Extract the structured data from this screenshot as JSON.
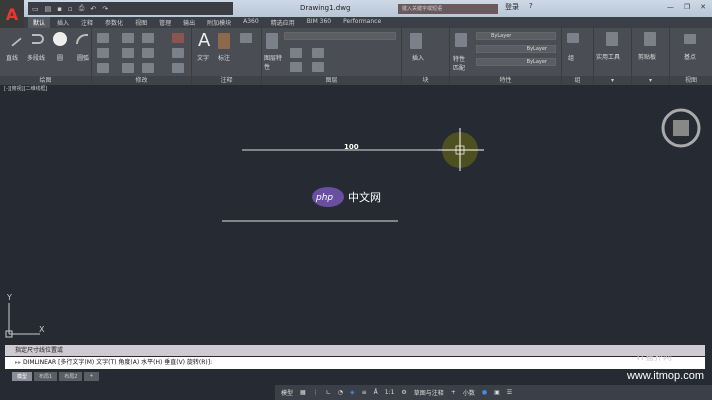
{
  "app": {
    "title": "Drawing1.dwg",
    "search_placeholder": "键入关键字或短语",
    "user": "登录",
    "help": "?"
  },
  "qat": [
    "新建",
    "打开",
    "保存",
    "另存",
    "打印",
    "放弃",
    "重做"
  ],
  "tabs": [
    "默认",
    "插入",
    "注释",
    "参数化",
    "视图",
    "管理",
    "输出",
    "附加模块",
    "A360",
    "精选应用",
    "BIM 360",
    "Performance"
  ],
  "ribbon": {
    "draw": {
      "label": "绘图",
      "items": [
        "直线",
        "多段线",
        "圆",
        "圆弧"
      ]
    },
    "modify": {
      "label": "修改"
    },
    "annotation": {
      "label": "注释",
      "items": [
        "文字",
        "标注"
      ]
    },
    "layers": {
      "label": "图层",
      "items": [
        "图层特性"
      ]
    },
    "block": {
      "label": "块",
      "items": [
        "插入"
      ]
    },
    "properties": {
      "label": "特性",
      "items": [
        "特性匹配"
      ],
      "color": "ByLayer",
      "linetype": "ByLayer",
      "lineweight": "ByLayer"
    },
    "groups": {
      "label": "组",
      "items": [
        "组"
      ]
    },
    "utilities": {
      "label": "实用工具"
    },
    "clipboard": {
      "label": "剪贴板",
      "items": [
        "剪贴板"
      ]
    },
    "view": {
      "label": "视图",
      "items": [
        "基点"
      ]
    }
  },
  "viewport_label": "[-][俯视][二维线框]",
  "drawing": {
    "dimension_text": "100",
    "ucs_x": "X",
    "ucs_y": "Y",
    "watermark_logo": "php中文网"
  },
  "command": {
    "history": "指定尺寸线位置或",
    "prompt": "DIMLINEAR [多行文字(M) 文字(T) 角度(A) 水平(H) 垂直(V) 旋转(R)]:"
  },
  "layout_tabs": [
    "模型",
    "布局1",
    "布局2",
    "+"
  ],
  "status": {
    "model": "模型",
    "annotation_scale": "1:1",
    "workspace": "草图与注释",
    "units": "小数"
  },
  "watermark": {
    "site": "www.itmop.com",
    "name": "IT猫扑网"
  }
}
